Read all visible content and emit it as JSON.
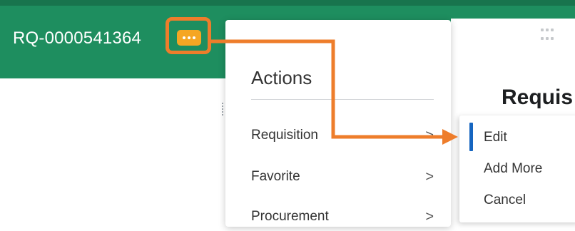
{
  "header": {
    "record_id": "RQ-0000541364",
    "related_actions_icon": "more-dots-icon"
  },
  "actions_menu": {
    "title": "Actions",
    "items": [
      {
        "label": "Requisition",
        "chevron": ">"
      },
      {
        "label": "Favorite",
        "chevron": ">"
      },
      {
        "label": "Procurement",
        "chevron": ">"
      }
    ]
  },
  "submenu": {
    "items": [
      {
        "label": "Edit",
        "active": true
      },
      {
        "label": "Add More"
      },
      {
        "label": "Cancel"
      }
    ]
  },
  "page": {
    "heading": "Requis",
    "apps_icon": "apps-grid-icon"
  },
  "colors": {
    "header_bg": "#1e8e5f",
    "callout_orange": "#ee7d2b",
    "button_orange": "#f5a623",
    "active_blue": "#1565c0"
  }
}
